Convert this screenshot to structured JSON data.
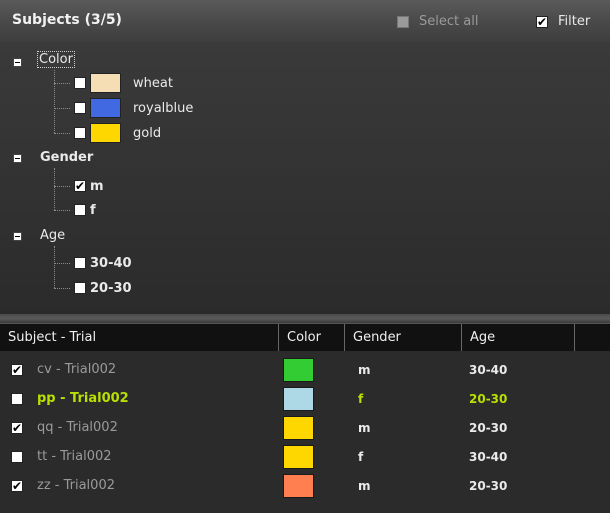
{
  "header": {
    "title": "Subjects (3/5)",
    "select_all_label": "Select all",
    "select_all_checked": false,
    "filter_label": "Filter",
    "filter_checked": true
  },
  "tree": {
    "categories": [
      {
        "label": "Color",
        "items": [
          {
            "label": "wheat",
            "checked": false,
            "swatch": "#f5deb3"
          },
          {
            "label": "royalblue",
            "checked": false,
            "swatch": "#4169e1"
          },
          {
            "label": "gold",
            "checked": false,
            "swatch": "#ffd700"
          }
        ]
      },
      {
        "label": "Gender",
        "items": [
          {
            "label": "m",
            "checked": true
          },
          {
            "label": "f",
            "checked": false
          }
        ]
      },
      {
        "label": "Age",
        "items": [
          {
            "label": "30-40",
            "checked": false
          },
          {
            "label": "20-30",
            "checked": false
          }
        ]
      }
    ]
  },
  "table": {
    "headers": [
      "Subject - Trial",
      "Color",
      "Gender",
      "Age"
    ],
    "rows": [
      {
        "checked": true,
        "trial": "cv - Trial002",
        "color": "#33cc33",
        "gender": "m",
        "age": "30-40",
        "highlight": false
      },
      {
        "checked": false,
        "trial": "pp - Trial002",
        "color": "#add8e6",
        "gender": "f",
        "age": "20-30",
        "highlight": true
      },
      {
        "checked": true,
        "trial": "qq - Trial002",
        "color": "#ffd700",
        "gender": "m",
        "age": "20-30",
        "highlight": false
      },
      {
        "checked": false,
        "trial": "tt - Trial002",
        "color": "#ffd700",
        "gender": "f",
        "age": "30-40",
        "highlight": false
      },
      {
        "checked": true,
        "trial": "zz - Trial002",
        "color": "#ff7f50",
        "gender": "m",
        "age": "20-30",
        "highlight": false
      }
    ]
  }
}
